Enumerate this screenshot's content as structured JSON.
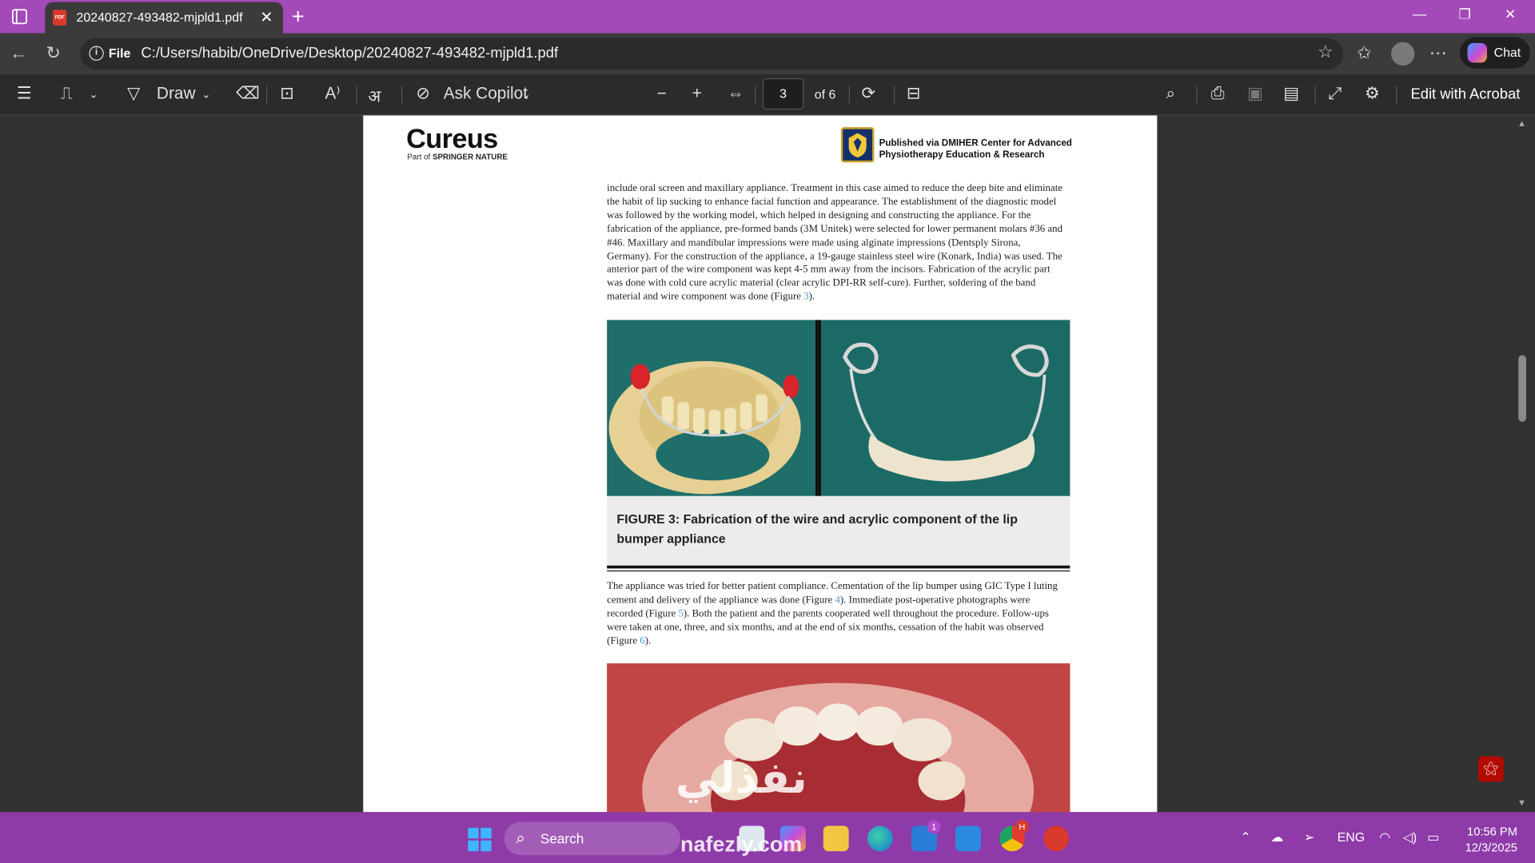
{
  "tab": {
    "title": "20240827-493482-mjpld1.pdf",
    "file_icon": "PDF"
  },
  "address": {
    "scheme": "File",
    "url": "C:/Users/habib/OneDrive/Desktop/20240827-493482-mjpld1.pdf"
  },
  "chat": {
    "label": "Chat"
  },
  "toolbar": {
    "draw_label": "Draw",
    "ask_copilot_label": "Ask Copilot",
    "page_current": "3",
    "page_total": "of 6",
    "edit_acrobat_label": "Edit with Acrobat"
  },
  "page": {
    "logo": "Cureus",
    "logo_sub_prefix": "Part of ",
    "logo_sub_brand": "SPRINGER NATURE",
    "publisher_line1": "Published via DMIHER Center for Advanced",
    "publisher_line2": "Physiotherapy Education & Research",
    "para1": "include oral screen and maxillary appliance. Treatment in this case aimed to reduce the deep bite and eliminate the habit of lip sucking to enhance facial function and appearance. The establishment of the diagnostic model was followed by the working model, which helped in designing and constructing the appliance. For the fabrication of the appliance, pre-formed bands (3M Unitek) were selected for lower permanent molars #36 and #46. Maxillary and mandibular impressions were made using alginate impressions (Dentsply Sirona, Germany). For the construction of the appliance, a 19-gauge stainless steel wire (Konark, India) was used. The anterior part of the wire component was kept 4-5 mm away from the incisors. Fabrication of the acrylic part was done with cold cure acrylic material (clear acrylic DPI-RR self-cure). Further, soldering of the band material and wire component was done (Figure ",
    "para1_ref": "3",
    "para1_end": ").",
    "caption": "FIGURE 3: Fabrication of the wire and acrylic component of the lip bumper appliance",
    "para2_a": "The appliance was tried for better patient compliance. Cementation of the lip bumper using GIC Type I luting cement and delivery of the appliance was done (Figure ",
    "para2_ref1": "4",
    "para2_b": "). Immediate post-operative photographs were recorded (Figure ",
    "para2_ref2": "5",
    "para2_c": "). Both the patient and the parents cooperated well throughout the procedure. Follow-ups were taken at one, three, and six months, and at the end of six months, cessation of the habit was observed (Figure ",
    "para2_ref3": "6",
    "para2_d": ")."
  },
  "taskbar": {
    "search_label": "Search",
    "language": "ENG",
    "time": "10:56 PM",
    "date": "12/3/2025",
    "store_badge": "1",
    "chrome_badge": "H"
  },
  "watermark": {
    "arabic": "نفذلي",
    "latin": "nafezly.com"
  },
  "colors": {
    "titlebar": "#a349b8",
    "taskbar": "#8e3aa8",
    "link": "#4a9ad4"
  }
}
